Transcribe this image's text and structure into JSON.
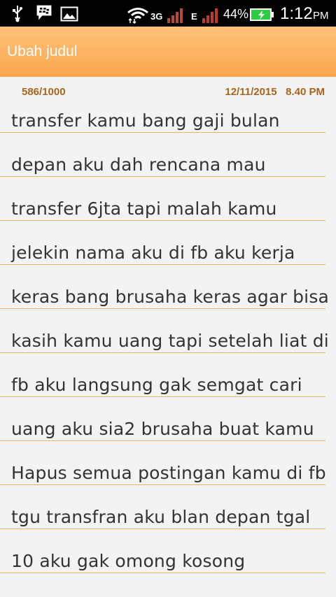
{
  "status_bar": {
    "network_3g": "3G",
    "network_e": "E",
    "battery_percent": "44%",
    "time": "1:12",
    "time_suffix": "PM",
    "icons": [
      "usb-icon",
      "bbm-icon",
      "gallery-icon",
      "wifi-icon",
      "signal-icon",
      "charging-battery-icon"
    ]
  },
  "app_bar": {
    "title": "Ubah judul"
  },
  "meta": {
    "char_count": "586/1000",
    "datetime": "12/11/2015   8.40 PM"
  },
  "note": {
    "lines": [
      "transfer kamu bang gaji bulan",
      "depan aku dah rencana mau",
      "transfer 6jta tapi malah kamu",
      "jelekin nama aku di fb aku kerja",
      "keras bang brusaha keras agar bisa",
      "kasih kamu uang tapi setelah liat di",
      "fb aku langsung gak semgat cari",
      "uang aku sia2 brusaha buat kamu",
      "Hapus semua postingan kamu di fb",
      "tgu transfran aku blan depan tgal",
      "10 aku gak omong kosong"
    ]
  },
  "colors": {
    "app_bar": "#f9a64d",
    "meta_text": "#a9641c",
    "rule_line": "#f0b35c",
    "background": "#f3f3f3"
  }
}
